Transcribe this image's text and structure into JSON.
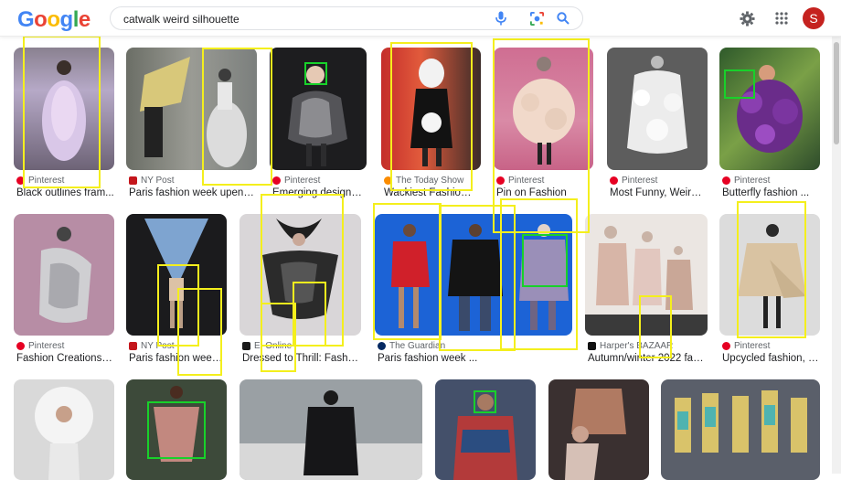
{
  "header": {
    "logo": "Google",
    "search_value": "catwalk weird silhouette",
    "avatar_letter": "S"
  },
  "row1": [
    {
      "source": "Pinterest",
      "title": "Black outlines fram...",
      "fav": "#e60023"
    },
    {
      "source": "NY Post",
      "title": "Paris fashion week upend...",
      "fav": "#c4161c"
    },
    {
      "source": "Pinterest",
      "title": "Emerging designers...",
      "fav": "#e60023"
    },
    {
      "source": "The Today Show",
      "title": "Wackiest Fashion ...",
      "fav": "#fb8c00"
    },
    {
      "source": "Pinterest",
      "title": "Pin on Fashion",
      "fav": "#e60023"
    },
    {
      "source": "Pinterest",
      "title": "Most Funny, Weird ...",
      "fav": "#e60023"
    },
    {
      "source": "Pinterest",
      "title": "Butterfly fashion ...",
      "fav": "#e60023"
    }
  ],
  "row2": [
    {
      "source": "Pinterest",
      "title": "Fashion Creations b...",
      "fav": "#e60023"
    },
    {
      "source": "NY Post",
      "title": "Paris fashion week ...",
      "fav": "#c4161c"
    },
    {
      "source": "E! Online",
      "title": "Dressed to Thrill: Fashio...",
      "fav": "#1a1a1a"
    },
    {
      "source": "The Guardian",
      "title": "Paris fashion week ...",
      "fav": "#052962"
    },
    {
      "source": "Harper's BAZAAR",
      "title": "Autumn/winter 2022 fas...",
      "fav": "#111111"
    },
    {
      "source": "Pinterest",
      "title": "Upcycled fashion, F...",
      "fav": "#e60023"
    }
  ],
  "colors": {
    "yellow_box": "#f4ef1d",
    "green_box": "#18d12a"
  }
}
